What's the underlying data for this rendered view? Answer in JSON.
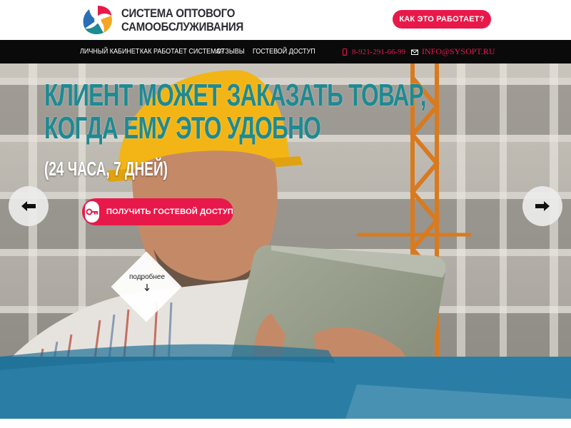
{
  "header": {
    "logo_line1": "СИСТЕМА ОПТОВОГО",
    "logo_line2": "САМООБСЛУЖИВАНИЯ",
    "how_button": "КАК ЭТО РАБОТАЕТ?"
  },
  "nav": {
    "items": [
      {
        "label": "ЛИЧНЫЙ КАБИНЕТ"
      },
      {
        "label": "КАК РАБОТАЕТ СИСТЕМА?"
      },
      {
        "label": "ОТЗЫВЫ"
      },
      {
        "label": "ГОСТЕВОЙ ДОСТУП"
      }
    ],
    "phone": "8-921-291-66-99",
    "email": "INFO@SYSOPT.RU"
  },
  "hero": {
    "headline_line1": "КЛИЕНТ МОЖЕТ ЗАКАЗАТЬ ТОВАР,",
    "headline_line2": "КОГДА ЕМУ ЭТО УДОБНО",
    "subhead": "(24 ЧАСА, 7 ДНЕЙ)",
    "cta": "ПОЛУЧИТЬ ГОСТЕВОЙ ДОСТУП",
    "more": "подробнее",
    "next_section": "КАК ЭТО РАБОТАЕТ?"
  },
  "colors": {
    "accent": "#e8194a",
    "headline": "#1e8a92",
    "navbar": "#0a0a0a",
    "band": "#2a7ea6"
  },
  "icons": [
    "logo-mark-icon",
    "phone-icon",
    "mail-icon",
    "key-icon",
    "arrow-left-icon",
    "arrow-right-icon",
    "arrow-down-icon"
  ]
}
